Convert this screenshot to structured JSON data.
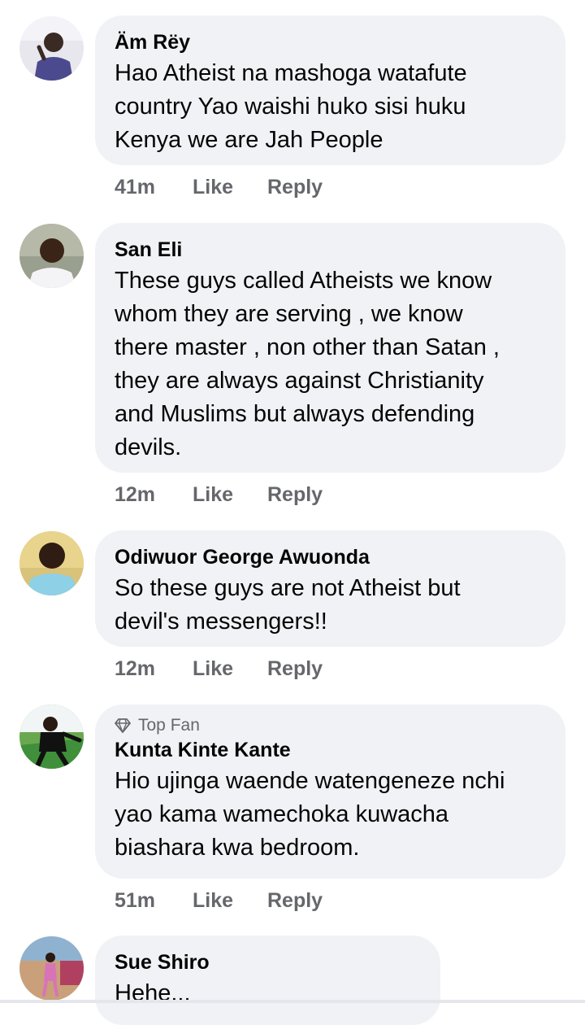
{
  "comments": [
    {
      "author": "Äm Rëy",
      "top_fan": false,
      "text_lines": [
        "Hao Atheist na mashoga watafute",
        "country Yao waishi huko sisi huku",
        "Kenya we are Jah People"
      ],
      "time": "41m",
      "like_label": "Like",
      "reply_label": "Reply",
      "avatar": "avatar-am-rey"
    },
    {
      "author": "San Eli",
      "top_fan": false,
      "text_lines": [
        "These guys called Atheists we know",
        "whom they are serving , we know",
        "there master , non other than Satan ,",
        "they are always against Christianity",
        "and Muslims but always defending",
        "devils."
      ],
      "time": "12m",
      "like_label": "Like",
      "reply_label": "Reply",
      "avatar": "avatar-san-eli"
    },
    {
      "author": "Odiwuor George Awuonda",
      "top_fan": false,
      "text_lines": [
        "So these guys are not Atheist but",
        "devil's messengers!!"
      ],
      "time": "12m",
      "like_label": "Like",
      "reply_label": "Reply",
      "avatar": "avatar-odiwuor"
    },
    {
      "author": "Kunta Kinte Kante",
      "top_fan": true,
      "top_fan_label": "Top Fan",
      "top_fan_icon": "diamond-icon",
      "text_lines": [
        "Hio ujinga waende watengeneze nchi",
        "yao kama wamechoka kuwacha",
        "biashara kwa bedroom."
      ],
      "time": "51m",
      "like_label": "Like",
      "reply_label": "Reply",
      "avatar": "avatar-kunta"
    },
    {
      "author": "Sue Shiro",
      "top_fan": false,
      "text_lines": [
        "Hehe..."
      ],
      "avatar": "avatar-sue-shiro"
    }
  ],
  "colors": {
    "bubble_bg": "#f0f2f5",
    "meta_text": "#65676b",
    "body_text": "#050505"
  }
}
